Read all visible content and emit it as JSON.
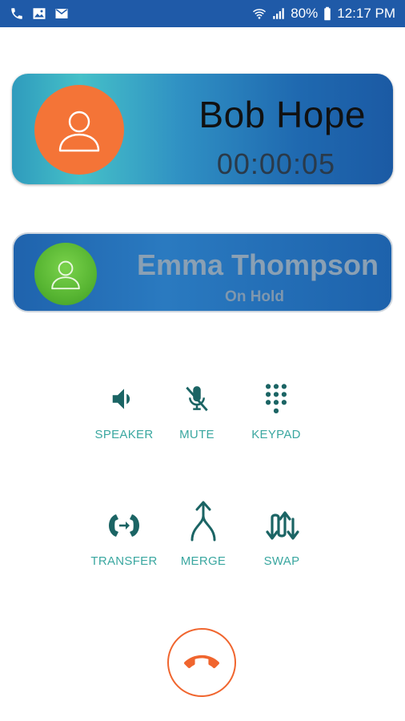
{
  "status_bar": {
    "battery": "80%",
    "time": "12:17 PM",
    "icons": [
      "phone-icon",
      "gallery-icon",
      "mail-icon",
      "wifi-call-icon",
      "signal-icon",
      "battery-icon"
    ]
  },
  "active_call": {
    "name": "Bob Hope",
    "duration": "00:00:05",
    "avatar_color": "#f47437"
  },
  "held_call": {
    "name": "Emma Thompson",
    "status": "On Hold",
    "avatar_color": "#57b532"
  },
  "controls": [
    {
      "label": "SPEAKER",
      "icon": "speaker-icon"
    },
    {
      "label": "MUTE",
      "icon": "mute-icon"
    },
    {
      "label": "KEYPAD",
      "icon": "keypad-icon"
    },
    {
      "label": "TRANSFER",
      "icon": "transfer-icon"
    },
    {
      "label": "MERGE",
      "icon": "merge-icon"
    },
    {
      "label": "SWAP",
      "icon": "swap-icon"
    }
  ],
  "end_call": {
    "icon": "end-call-icon",
    "color": "#f0652e"
  }
}
